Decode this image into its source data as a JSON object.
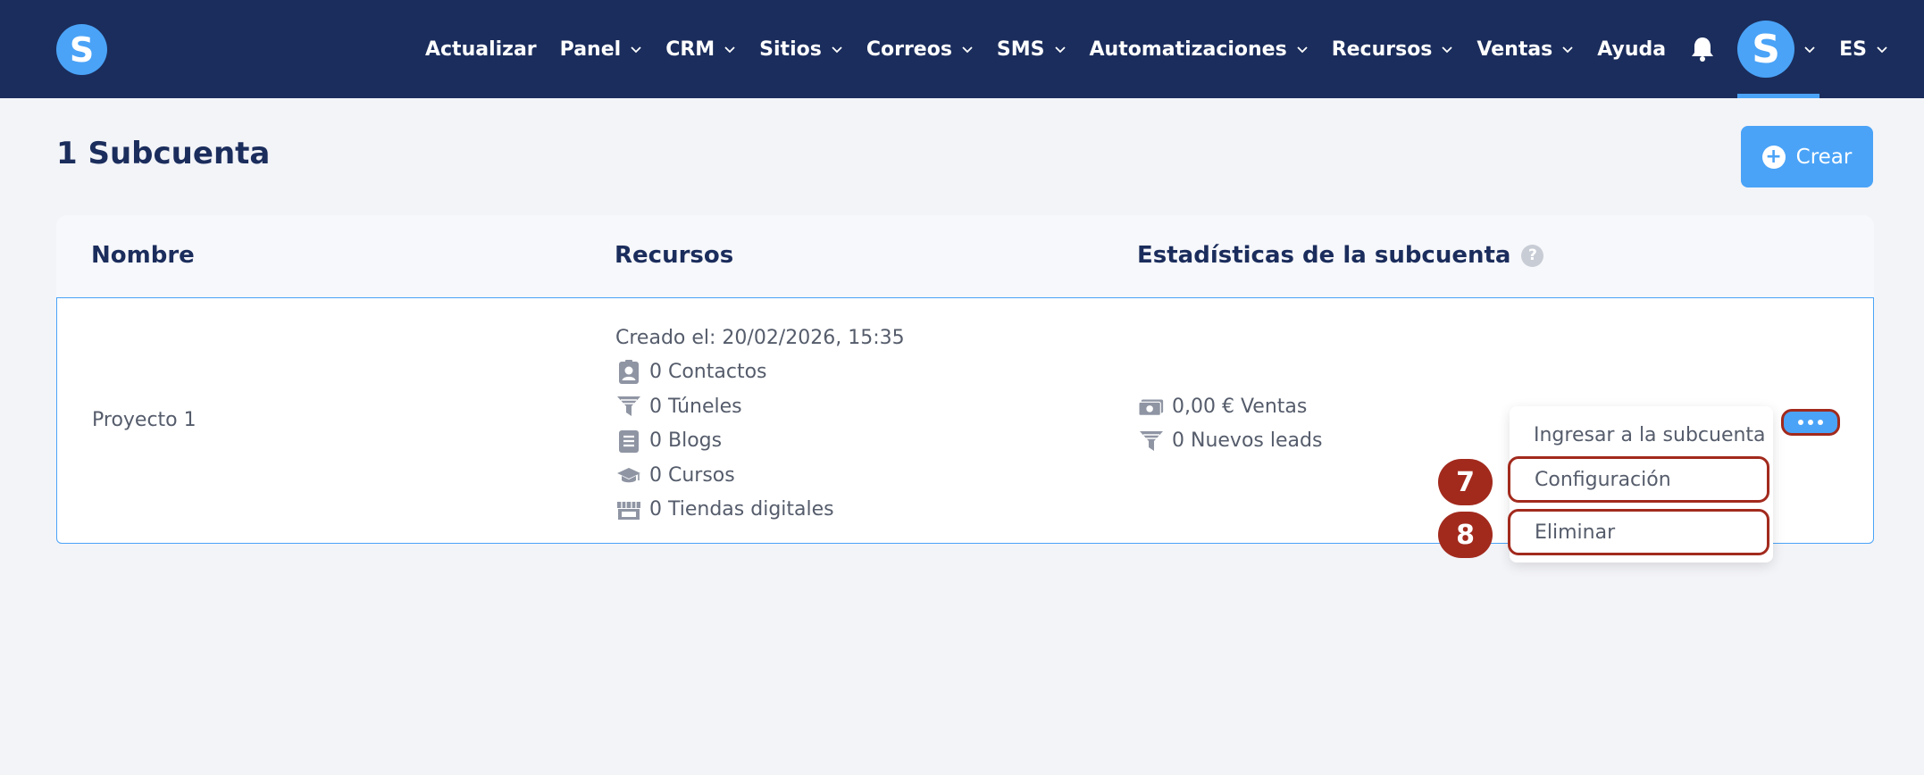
{
  "nav": {
    "logo_letter": "S",
    "items": [
      {
        "label": "Actualizar",
        "has_chevron": false
      },
      {
        "label": "Panel",
        "has_chevron": true
      },
      {
        "label": "CRM",
        "has_chevron": true
      },
      {
        "label": "Sitios",
        "has_chevron": true
      },
      {
        "label": "Correos",
        "has_chevron": true
      },
      {
        "label": "SMS",
        "has_chevron": true
      },
      {
        "label": "Automatizaciones",
        "has_chevron": true
      },
      {
        "label": "Recursos",
        "has_chevron": true
      },
      {
        "label": "Ventas",
        "has_chevron": true
      },
      {
        "label": "Ayuda",
        "has_chevron": false
      }
    ],
    "avatar_letter": "S",
    "language": "ES"
  },
  "page": {
    "title": "1 Subcuenta",
    "create_label": "Crear"
  },
  "table": {
    "headers": {
      "name": "Nombre",
      "resources": "Recursos",
      "stats": "Estadísticas de la subcuenta",
      "help": "?"
    },
    "row": {
      "name": "Proyecto 1",
      "created": "Creado el: 20/02/2026, 15:35",
      "resources": [
        {
          "icon": "contacts-icon",
          "label": "0 Contactos"
        },
        {
          "icon": "funnel-icon",
          "label": "0 Túneles"
        },
        {
          "icon": "blog-icon",
          "label": "0 Blogs"
        },
        {
          "icon": "graduation-cap-icon",
          "label": "0 Cursos"
        },
        {
          "icon": "store-icon",
          "label": "0 Tiendas digitales"
        }
      ],
      "stats": [
        {
          "icon": "money-icon",
          "label": "0,00 € Ventas"
        },
        {
          "icon": "funnel-icon",
          "label": "0 Nuevos leads"
        }
      ]
    }
  },
  "dropdown": {
    "items": [
      {
        "label": "Ingresar a la subcuenta"
      },
      {
        "label": "Configuración",
        "badge": "7"
      },
      {
        "label": "Eliminar",
        "badge": "8"
      }
    ]
  },
  "colors": {
    "navbar": "#1b2d5c",
    "accent": "#4aa3f7",
    "highlight": "#a22a1d",
    "background": "#f3f4f8"
  }
}
